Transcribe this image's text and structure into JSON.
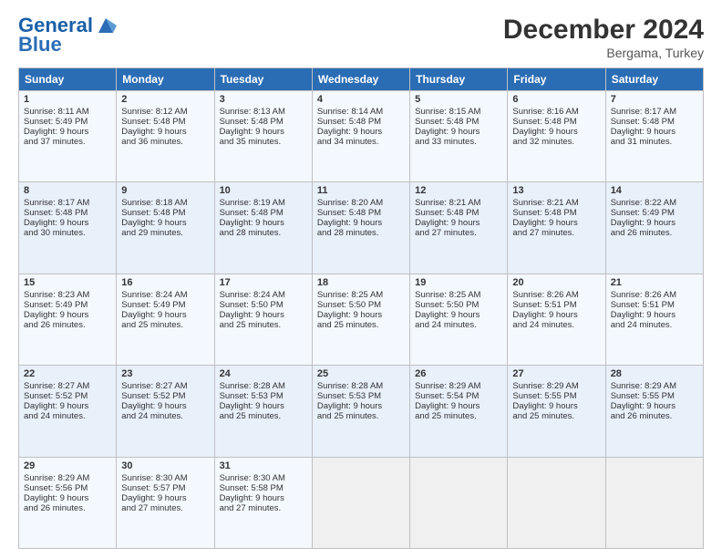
{
  "header": {
    "logo_line1": "General",
    "logo_line2": "Blue",
    "month": "December 2024",
    "location": "Bergama, Turkey"
  },
  "weekdays": [
    "Sunday",
    "Monday",
    "Tuesday",
    "Wednesday",
    "Thursday",
    "Friday",
    "Saturday"
  ],
  "weeks": [
    [
      {
        "day": "1",
        "lines": [
          "Sunrise: 8:11 AM",
          "Sunset: 5:49 PM",
          "Daylight: 9 hours",
          "and 37 minutes."
        ]
      },
      {
        "day": "2",
        "lines": [
          "Sunrise: 8:12 AM",
          "Sunset: 5:48 PM",
          "Daylight: 9 hours",
          "and 36 minutes."
        ]
      },
      {
        "day": "3",
        "lines": [
          "Sunrise: 8:13 AM",
          "Sunset: 5:48 PM",
          "Daylight: 9 hours",
          "and 35 minutes."
        ]
      },
      {
        "day": "4",
        "lines": [
          "Sunrise: 8:14 AM",
          "Sunset: 5:48 PM",
          "Daylight: 9 hours",
          "and 34 minutes."
        ]
      },
      {
        "day": "5",
        "lines": [
          "Sunrise: 8:15 AM",
          "Sunset: 5:48 PM",
          "Daylight: 9 hours",
          "and 33 minutes."
        ]
      },
      {
        "day": "6",
        "lines": [
          "Sunrise: 8:16 AM",
          "Sunset: 5:48 PM",
          "Daylight: 9 hours",
          "and 32 minutes."
        ]
      },
      {
        "day": "7",
        "lines": [
          "Sunrise: 8:17 AM",
          "Sunset: 5:48 PM",
          "Daylight: 9 hours",
          "and 31 minutes."
        ]
      }
    ],
    [
      {
        "day": "8",
        "lines": [
          "Sunrise: 8:17 AM",
          "Sunset: 5:48 PM",
          "Daylight: 9 hours",
          "and 30 minutes."
        ]
      },
      {
        "day": "9",
        "lines": [
          "Sunrise: 8:18 AM",
          "Sunset: 5:48 PM",
          "Daylight: 9 hours",
          "and 29 minutes."
        ]
      },
      {
        "day": "10",
        "lines": [
          "Sunrise: 8:19 AM",
          "Sunset: 5:48 PM",
          "Daylight: 9 hours",
          "and 28 minutes."
        ]
      },
      {
        "day": "11",
        "lines": [
          "Sunrise: 8:20 AM",
          "Sunset: 5:48 PM",
          "Daylight: 9 hours",
          "and 28 minutes."
        ]
      },
      {
        "day": "12",
        "lines": [
          "Sunrise: 8:21 AM",
          "Sunset: 5:48 PM",
          "Daylight: 9 hours",
          "and 27 minutes."
        ]
      },
      {
        "day": "13",
        "lines": [
          "Sunrise: 8:21 AM",
          "Sunset: 5:48 PM",
          "Daylight: 9 hours",
          "and 27 minutes."
        ]
      },
      {
        "day": "14",
        "lines": [
          "Sunrise: 8:22 AM",
          "Sunset: 5:49 PM",
          "Daylight: 9 hours",
          "and 26 minutes."
        ]
      }
    ],
    [
      {
        "day": "15",
        "lines": [
          "Sunrise: 8:23 AM",
          "Sunset: 5:49 PM",
          "Daylight: 9 hours",
          "and 26 minutes."
        ]
      },
      {
        "day": "16",
        "lines": [
          "Sunrise: 8:24 AM",
          "Sunset: 5:49 PM",
          "Daylight: 9 hours",
          "and 25 minutes."
        ]
      },
      {
        "day": "17",
        "lines": [
          "Sunrise: 8:24 AM",
          "Sunset: 5:50 PM",
          "Daylight: 9 hours",
          "and 25 minutes."
        ]
      },
      {
        "day": "18",
        "lines": [
          "Sunrise: 8:25 AM",
          "Sunset: 5:50 PM",
          "Daylight: 9 hours",
          "and 25 minutes."
        ]
      },
      {
        "day": "19",
        "lines": [
          "Sunrise: 8:25 AM",
          "Sunset: 5:50 PM",
          "Daylight: 9 hours",
          "and 24 minutes."
        ]
      },
      {
        "day": "20",
        "lines": [
          "Sunrise: 8:26 AM",
          "Sunset: 5:51 PM",
          "Daylight: 9 hours",
          "and 24 minutes."
        ]
      },
      {
        "day": "21",
        "lines": [
          "Sunrise: 8:26 AM",
          "Sunset: 5:51 PM",
          "Daylight: 9 hours",
          "and 24 minutes."
        ]
      }
    ],
    [
      {
        "day": "22",
        "lines": [
          "Sunrise: 8:27 AM",
          "Sunset: 5:52 PM",
          "Daylight: 9 hours",
          "and 24 minutes."
        ]
      },
      {
        "day": "23",
        "lines": [
          "Sunrise: 8:27 AM",
          "Sunset: 5:52 PM",
          "Daylight: 9 hours",
          "and 24 minutes."
        ]
      },
      {
        "day": "24",
        "lines": [
          "Sunrise: 8:28 AM",
          "Sunset: 5:53 PM",
          "Daylight: 9 hours",
          "and 25 minutes."
        ]
      },
      {
        "day": "25",
        "lines": [
          "Sunrise: 8:28 AM",
          "Sunset: 5:53 PM",
          "Daylight: 9 hours",
          "and 25 minutes."
        ]
      },
      {
        "day": "26",
        "lines": [
          "Sunrise: 8:29 AM",
          "Sunset: 5:54 PM",
          "Daylight: 9 hours",
          "and 25 minutes."
        ]
      },
      {
        "day": "27",
        "lines": [
          "Sunrise: 8:29 AM",
          "Sunset: 5:55 PM",
          "Daylight: 9 hours",
          "and 25 minutes."
        ]
      },
      {
        "day": "28",
        "lines": [
          "Sunrise: 8:29 AM",
          "Sunset: 5:55 PM",
          "Daylight: 9 hours",
          "and 26 minutes."
        ]
      }
    ],
    [
      {
        "day": "29",
        "lines": [
          "Sunrise: 8:29 AM",
          "Sunset: 5:56 PM",
          "Daylight: 9 hours",
          "and 26 minutes."
        ]
      },
      {
        "day": "30",
        "lines": [
          "Sunrise: 8:30 AM",
          "Sunset: 5:57 PM",
          "Daylight: 9 hours",
          "and 27 minutes."
        ]
      },
      {
        "day": "31",
        "lines": [
          "Sunrise: 8:30 AM",
          "Sunset: 5:58 PM",
          "Daylight: 9 hours",
          "and 27 minutes."
        ]
      },
      {
        "day": "",
        "lines": []
      },
      {
        "day": "",
        "lines": []
      },
      {
        "day": "",
        "lines": []
      },
      {
        "day": "",
        "lines": []
      }
    ]
  ]
}
